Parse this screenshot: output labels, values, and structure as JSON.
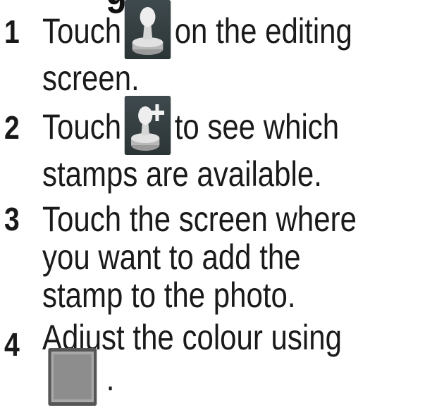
{
  "heading_fragment": "g  p",
  "steps": [
    {
      "number": "1",
      "before_icon": "Touch",
      "icon": "stamp-icon",
      "after_icon": "on the editing screen."
    },
    {
      "number": "2",
      "before_icon": "Touch",
      "icon": "add-stamp-icon",
      "after_icon": "to see which stamps are available."
    },
    {
      "number": "3",
      "text": "Touch the screen where you want to add the stamp to the photo."
    },
    {
      "number": "4",
      "before_icon": "Adjust the colour using",
      "icon": "colour-swatch-icon",
      "after_icon": "."
    }
  ],
  "colors": {
    "text": "#1a1a1a",
    "icon_background": "#333b3e",
    "swatch": "#8d8d8d"
  }
}
